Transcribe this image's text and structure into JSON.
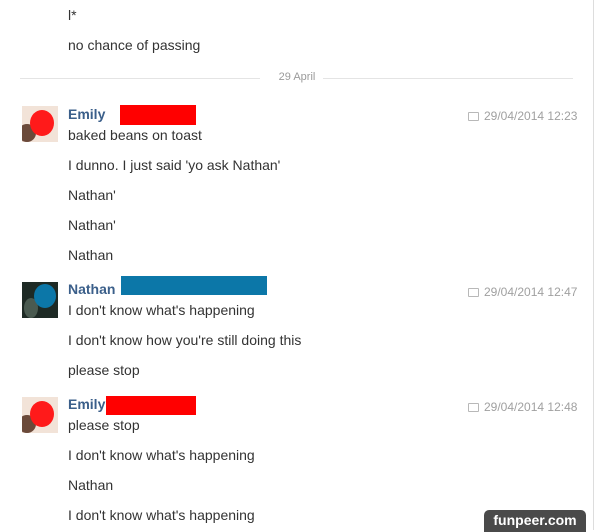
{
  "header_messages": [
    "l*",
    "no chance of passing"
  ],
  "date_separator": "29 April",
  "groups": [
    {
      "sender": "Emily",
      "timestamp": "29/04/2014 12:23",
      "messages": [
        "baked beans on toast",
        "I dunno. I just said 'yo ask Nathan'",
        "Nathan'",
        "Nathan'",
        "Nathan"
      ]
    },
    {
      "sender": "Nathan",
      "timestamp": "29/04/2014 12:47",
      "messages": [
        "I don't know what's happening",
        "I don't know how you're still doing this",
        "please stop"
      ]
    },
    {
      "sender": "Emily",
      "timestamp": "29/04/2014 12:48",
      "messages": [
        "please stop",
        "I don't know what's happening",
        "Nathan",
        "I don't know what's happening"
      ]
    }
  ],
  "redaction_colors": {
    "emily": "#ff0000",
    "nathan": "#0c77a8"
  },
  "icons": {
    "timestamp": "chat-bubble-icon"
  },
  "watermark": "funpeer.com"
}
